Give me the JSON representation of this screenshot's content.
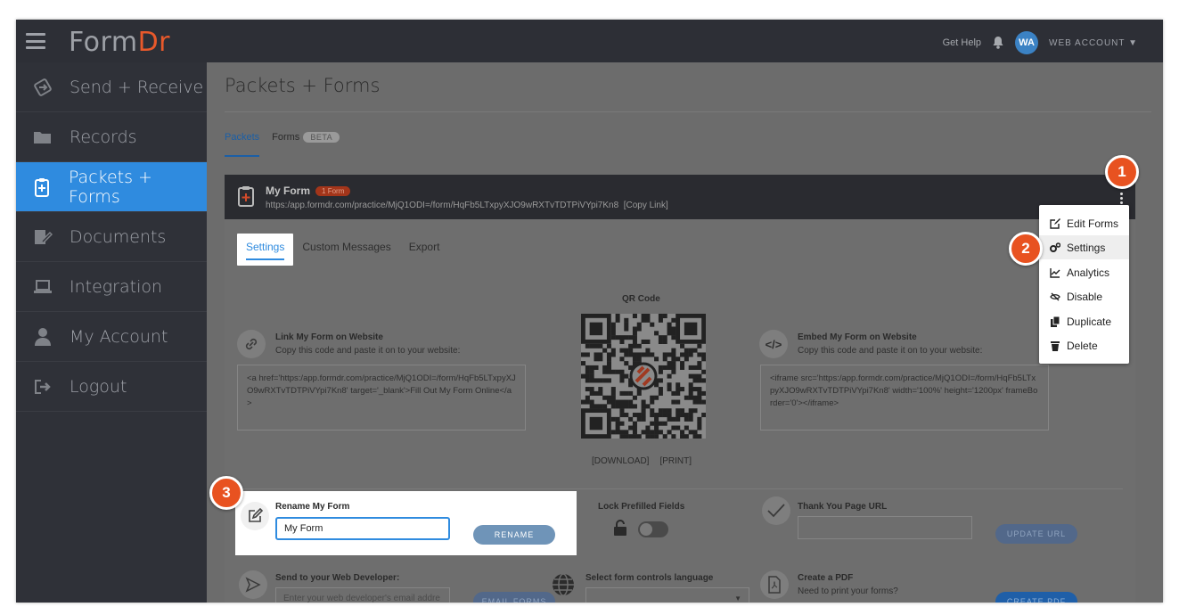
{
  "app": {
    "logo_form": "Form",
    "logo_dr": "Dr"
  },
  "topbar": {
    "get_help": "Get Help",
    "avatar_initials": "WA",
    "account_label": "WEB ACCOUNT ▼"
  },
  "sidebar": {
    "items": [
      {
        "label": "Send + Receive",
        "icon": "send-receive-icon"
      },
      {
        "label": "Records",
        "icon": "folder-icon"
      },
      {
        "label": "Packets + Forms",
        "icon": "clipboard-icon",
        "active": true
      },
      {
        "label": "Documents",
        "icon": "document-edit-icon"
      },
      {
        "label": "Integration",
        "icon": "laptop-icon"
      },
      {
        "label": "My Account",
        "icon": "user-icon"
      },
      {
        "label": "Logout",
        "icon": "logout-icon"
      }
    ]
  },
  "main": {
    "title": "Packets + Forms",
    "tabs": {
      "packets": "Packets",
      "forms": "Forms",
      "forms_badge": "BETA"
    },
    "form": {
      "name": "My Form",
      "badge": "1 Form",
      "url": "https:/app.formdr.com/practice/MjQ1ODI=/form/HqFb5LTxpyXJO9wRXTvTDTPiVYpi7Kn8",
      "copy_link": "[Copy Link]"
    },
    "subtabs": {
      "settings": "Settings",
      "custom_messages": "Custom Messages",
      "export": "Export"
    },
    "qr": {
      "label": "QR Code",
      "download": "[DOWNLOAD]",
      "print": "[PRINT]"
    },
    "link_section": {
      "title": "Link My Form on Website",
      "subtitle": "Copy this code and paste it on to your website:",
      "code": "<a href='https:/app.formdr.com/practice/MjQ1ODI=/form/HqFb5LTxpyXJO9wRXTvTDTPiVYpi7Kn8' target='_blank'>Fill Out My Form Online</a>"
    },
    "embed_section": {
      "title": "Embed My Form on Website",
      "subtitle": "Copy this code and paste it on to your website:",
      "code": "<iframe src='https:/app.formdr.com/practice/MjQ1ODI=/form/HqFb5LTxpyXJO9wRXTvTDTPiVYpi7Kn8' width='100%' height='1200px' frameBorder='0'></iframe>"
    },
    "rename": {
      "title": "Rename My Form",
      "value": "My Form",
      "button": "RENAME"
    },
    "lock": {
      "title": "Lock Prefilled Fields",
      "enabled": false
    },
    "thank_you": {
      "title": "Thank You Page URL",
      "value": "",
      "button": "UPDATE URL"
    },
    "developer": {
      "title": "Send to your Web Developer:",
      "placeholder": "Enter your web developer's email addre",
      "button": "EMAIL FORMS"
    },
    "language": {
      "title": "Select form controls language",
      "value": ""
    },
    "pdf": {
      "title": "Create a PDF",
      "subtitle": "Need to print your forms?",
      "button": "CREATE PDF"
    }
  },
  "menu": {
    "items": [
      {
        "label": "Edit Forms",
        "icon": "edit-icon"
      },
      {
        "label": "Settings",
        "icon": "cogs-icon",
        "highlighted": true
      },
      {
        "label": "Analytics",
        "icon": "chart-line-icon"
      },
      {
        "label": "Disable",
        "icon": "eye-slash-icon"
      },
      {
        "label": "Duplicate",
        "icon": "copy-icon"
      },
      {
        "label": "Delete",
        "icon": "trash-icon"
      }
    ]
  },
  "steps": [
    "1",
    "2",
    "3"
  ]
}
